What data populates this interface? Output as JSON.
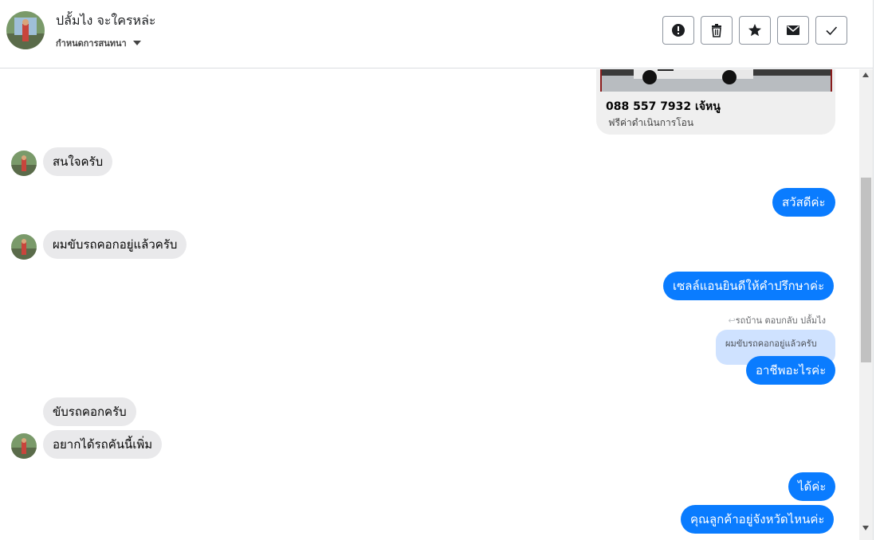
{
  "header": {
    "contact_name": "ปลั้มไง จะใครหล่ะ",
    "subtitle": "กำหนดการสนทนา",
    "actions": [
      {
        "name": "report-button",
        "icon": "exclamation-icon"
      },
      {
        "name": "delete-button",
        "icon": "trash-icon"
      },
      {
        "name": "star-button",
        "icon": "star-icon"
      },
      {
        "name": "mail-button",
        "icon": "envelope-icon"
      },
      {
        "name": "done-button",
        "icon": "check-icon"
      }
    ]
  },
  "card": {
    "title": "088 557 7932 เจ้หนู",
    "description": "ฟรีค่าดำเนินการโอน"
  },
  "messages": {
    "m1": "สนใจครับ",
    "m2": "สวัสดีค่ะ",
    "m3": "ผมขับรถคอกอยู่แล้วครับ",
    "m4": "เซลล์แอนยินดีให้คำปรึกษาค่ะ",
    "reply_note": "รถบ้าน ตอบกลับ ปลั้มไง",
    "quoted": "ผมขับรถคอกอยู่แล้วครับ",
    "m5": "อาชีพอะไรค่ะ",
    "m6": "ขับรถคอกครับ",
    "m7": "อยากได้รถคันนี้เพิ่ม",
    "m8": "ได้ค่ะ",
    "m9": "คุณลูกค้าอยู่จังหวัดไหนค่ะ"
  },
  "colors": {
    "outgoing": "#0a7cff",
    "incoming": "#e9e9eb",
    "quoted": "#cfe2ff"
  }
}
